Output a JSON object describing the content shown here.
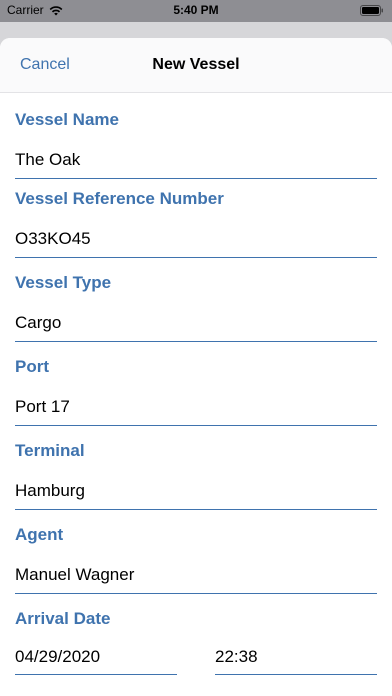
{
  "status_bar": {
    "carrier": "Carrier",
    "time": "5:40 PM"
  },
  "nav": {
    "cancel_label": "Cancel",
    "title": "New Vessel"
  },
  "fields": {
    "vessel_name": {
      "label": "Vessel Name",
      "value": "The Oak"
    },
    "vessel_reference_number": {
      "label": "Vessel Reference Number",
      "value": "O33KO45"
    },
    "vessel_type": {
      "label": "Vessel Type",
      "value": "Cargo"
    },
    "port": {
      "label": "Port",
      "value": "Port 17"
    },
    "terminal": {
      "label": "Terminal",
      "value": "Hamburg"
    },
    "agent": {
      "label": "Agent",
      "value": "Manuel Wagner"
    },
    "arrival_date": {
      "label": "Arrival Date",
      "date": "04/29/2020",
      "time": "22:38"
    }
  },
  "colors": {
    "accent": "#3f73ae",
    "underline": "#3f73ae"
  },
  "icons": {
    "wifi": "wifi-icon",
    "battery": "battery-icon"
  }
}
